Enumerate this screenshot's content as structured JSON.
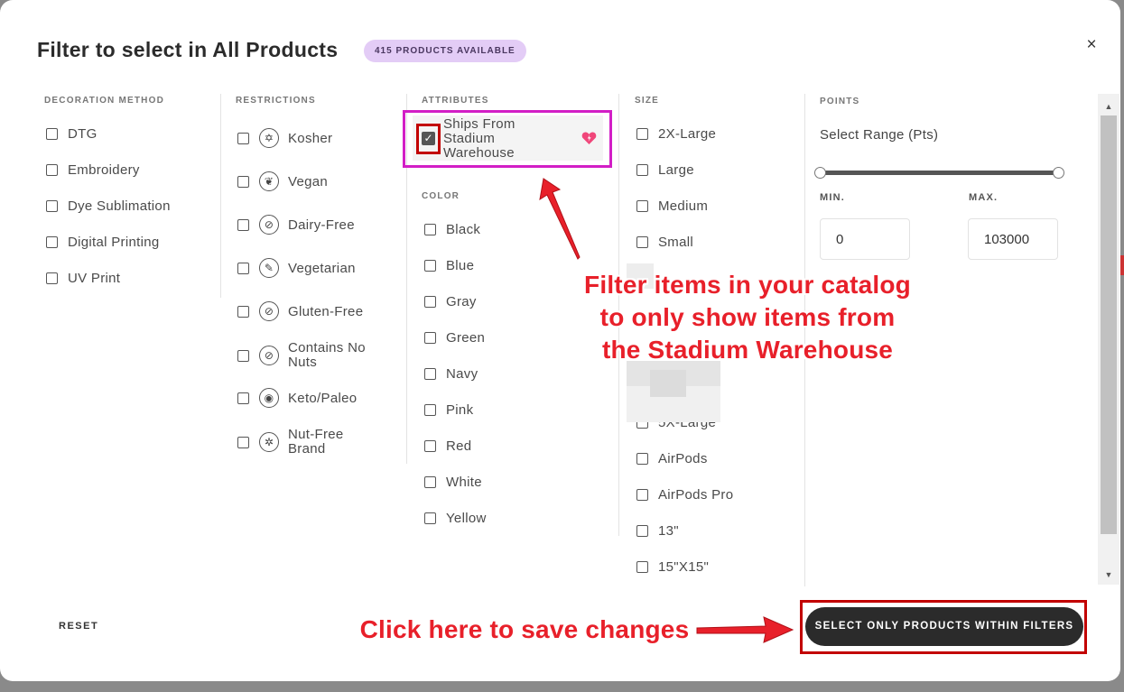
{
  "modal": {
    "title": "Filter to select in All Products",
    "badge": "415 PRODUCTS AVAILABLE",
    "close_glyph": "×"
  },
  "columns": {
    "decoration": {
      "heading": "DECORATION METHOD",
      "items": [
        "DTG",
        "Embroidery",
        "Dye Sublimation",
        "Digital Printing",
        "UV Print"
      ]
    },
    "restrictions": {
      "heading": "RESTRICTIONS",
      "items": [
        {
          "label": "Kosher",
          "icon": "star-of-david-icon",
          "glyph": "✡"
        },
        {
          "label": "Vegan",
          "icon": "leaf-icon",
          "glyph": "❦"
        },
        {
          "label": "Dairy-Free",
          "icon": "no-dairy-icon",
          "glyph": "⊘"
        },
        {
          "label": "Vegetarian",
          "icon": "carrot-icon",
          "glyph": "✎"
        },
        {
          "label": "Gluten-Free",
          "icon": "no-wheat-icon",
          "glyph": "⊘"
        },
        {
          "label": "Contains No Nuts",
          "icon": "no-nut-icon",
          "glyph": "⊘"
        },
        {
          "label": "Keto/Paleo",
          "icon": "avocado-icon",
          "glyph": "◉"
        },
        {
          "label": "Nut-Free Brand",
          "icon": "nut-free-brand-icon",
          "glyph": "✲"
        }
      ]
    },
    "attributes": {
      "heading": "ATTRIBUTES",
      "selected_item": "Ships From Stadium Warehouse",
      "check_glyph": "✓"
    },
    "color": {
      "heading": "COLOR",
      "items": [
        "Black",
        "Blue",
        "Gray",
        "Green",
        "Navy",
        "Pink",
        "Red",
        "White",
        "Yellow"
      ]
    },
    "size": {
      "heading": "SIZE",
      "items_top": [
        "2X-Large",
        "Large",
        "Medium",
        "Small"
      ],
      "items_bottom": [
        "5X-Large",
        "AirPods",
        "AirPods Pro",
        "13\"",
        "15\"X15\""
      ]
    },
    "points": {
      "heading": "POINTS",
      "range_label": "Select Range (Pts)",
      "min_label": "MIN.",
      "max_label": "MAX.",
      "min_value": "0",
      "max_value": "103000",
      "range_min_fraction": 0,
      "range_max_fraction": 1
    }
  },
  "footer": {
    "reset_label": "RESET",
    "save_label": "SELECT ONLY PRODUCTS WITHIN FILTERS"
  },
  "annotations": {
    "callout_lines": [
      "Filter items in your catalog",
      "to only show items from",
      "the Stadium Warehouse"
    ],
    "save_hint": "Click here to save changes",
    "annotation_color": "#e8202a",
    "highlight_color": "#d21ec6",
    "box_color": "#c20000"
  },
  "scrollbar": {
    "up_glyph": "▲",
    "down_glyph": "▼"
  }
}
